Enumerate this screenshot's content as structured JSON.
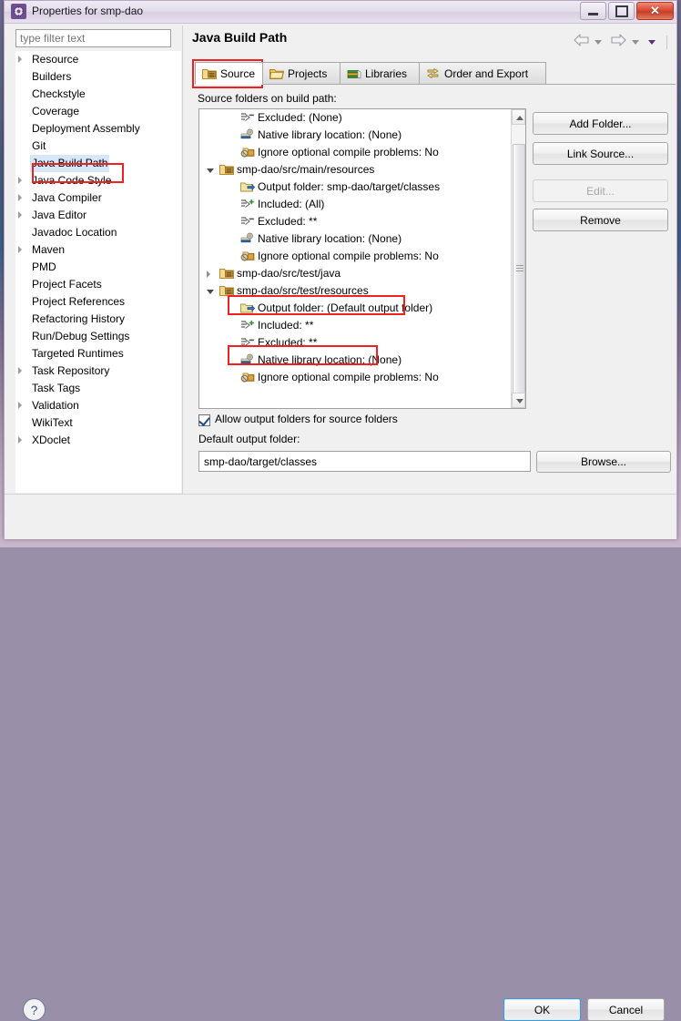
{
  "window": {
    "title": "Properties for smp-dao",
    "icon": "properties-gear-icon",
    "minimize_label": "Minimize",
    "maximize_label": "Maximize",
    "close_label": "Close",
    "close_glyph": "✕"
  },
  "filter": {
    "placeholder": "type filter text",
    "value": ""
  },
  "sidebar": {
    "items": [
      {
        "label": "Resource",
        "expandable": true,
        "selected": false
      },
      {
        "label": "Builders",
        "expandable": false,
        "selected": false
      },
      {
        "label": "Checkstyle",
        "expandable": false,
        "selected": false
      },
      {
        "label": "Coverage",
        "expandable": false,
        "selected": false
      },
      {
        "label": "Deployment Assembly",
        "expandable": false,
        "selected": false
      },
      {
        "label": "Git",
        "expandable": false,
        "selected": false
      },
      {
        "label": "Java Build Path",
        "expandable": false,
        "selected": true
      },
      {
        "label": "Java Code Style",
        "expandable": true,
        "selected": false
      },
      {
        "label": "Java Compiler",
        "expandable": true,
        "selected": false
      },
      {
        "label": "Java Editor",
        "expandable": true,
        "selected": false
      },
      {
        "label": "Javadoc Location",
        "expandable": false,
        "selected": false
      },
      {
        "label": "Maven",
        "expandable": true,
        "selected": false
      },
      {
        "label": "PMD",
        "expandable": false,
        "selected": false
      },
      {
        "label": "Project Facets",
        "expandable": false,
        "selected": false
      },
      {
        "label": "Project References",
        "expandable": false,
        "selected": false
      },
      {
        "label": "Refactoring History",
        "expandable": false,
        "selected": false
      },
      {
        "label": "Run/Debug Settings",
        "expandable": false,
        "selected": false
      },
      {
        "label": "Targeted Runtimes",
        "expandable": false,
        "selected": false
      },
      {
        "label": "Task Repository",
        "expandable": true,
        "selected": false
      },
      {
        "label": "Task Tags",
        "expandable": false,
        "selected": false
      },
      {
        "label": "Validation",
        "expandable": true,
        "selected": false
      },
      {
        "label": "WikiText",
        "expandable": false,
        "selected": false
      },
      {
        "label": "XDoclet",
        "expandable": true,
        "selected": false
      }
    ]
  },
  "page": {
    "title": "Java Build Path",
    "nav": {
      "back_icon": "arrow-left-icon",
      "back_menu_icon": "chevron-down-icon",
      "forward_icon": "arrow-right-icon",
      "forward_menu_icon": "chevron-down-icon",
      "view_menu_icon": "chevron-down-icon"
    },
    "tabs": [
      {
        "label": "Source",
        "icon": "source-folder-icon",
        "active": true
      },
      {
        "label": "Projects",
        "icon": "projects-folder-icon",
        "active": false
      },
      {
        "label": "Libraries",
        "icon": "libraries-books-icon",
        "active": false
      },
      {
        "label": "Order and Export",
        "icon": "order-export-icon",
        "active": false
      }
    ],
    "source_label": "Source folders on build path:"
  },
  "tree": {
    "rows": [
      {
        "label": "Excluded: (None)",
        "icon": "exclusion-filter-icon",
        "indent": 2,
        "toggle": "none"
      },
      {
        "label": "Native library location: (None)",
        "icon": "native-library-icon",
        "indent": 2,
        "toggle": "none"
      },
      {
        "label": "Ignore optional compile problems: No",
        "icon": "ignore-problems-icon",
        "indent": 2,
        "toggle": "none"
      },
      {
        "label": "smp-dao/src/main/resources",
        "icon": "source-folder-icon",
        "indent": 1,
        "toggle": "open"
      },
      {
        "label": "Output folder: smp-dao/target/classes",
        "icon": "output-folder-icon",
        "indent": 2,
        "toggle": "none"
      },
      {
        "label": "Included: (All)",
        "icon": "inclusion-filter-icon",
        "indent": 2,
        "toggle": "none"
      },
      {
        "label": "Excluded: **",
        "icon": "exclusion-filter-icon",
        "indent": 2,
        "toggle": "none"
      },
      {
        "label": "Native library location: (None)",
        "icon": "native-library-icon",
        "indent": 2,
        "toggle": "none"
      },
      {
        "label": "Ignore optional compile problems: No",
        "icon": "ignore-problems-icon",
        "indent": 2,
        "toggle": "none"
      },
      {
        "label": "smp-dao/src/test/java",
        "icon": "source-folder-icon",
        "indent": 1,
        "toggle": "closed"
      },
      {
        "label": "smp-dao/src/test/resources",
        "icon": "source-folder-icon",
        "indent": 1,
        "toggle": "open"
      },
      {
        "label": "Output folder: (Default output folder)",
        "icon": "output-folder-icon",
        "indent": 2,
        "toggle": "none"
      },
      {
        "label": "Included: **",
        "icon": "inclusion-filter-icon",
        "indent": 2,
        "toggle": "none"
      },
      {
        "label": "Excluded: **",
        "icon": "exclusion-filter-icon",
        "indent": 2,
        "toggle": "none"
      },
      {
        "label": "Native library location: (None)",
        "icon": "native-library-icon",
        "indent": 2,
        "toggle": "none"
      },
      {
        "label": "Ignore optional compile problems: No",
        "icon": "ignore-problems-icon",
        "indent": 2,
        "toggle": "none"
      }
    ],
    "scrollbar": {
      "up_icon": "scroll-up-icon",
      "down_icon": "scroll-down-icon",
      "thumb_grip_icon": "scroll-grip-icon"
    }
  },
  "side_buttons": {
    "add_folder": "Add Folder...",
    "link_source": "Link Source...",
    "edit": "Edit...",
    "remove": "Remove"
  },
  "output": {
    "allow_checkbox_label": "Allow output folders for source folders",
    "allow_checked": true,
    "default_label": "Default output folder:",
    "default_value": "smp-dao/target/classes",
    "browse": "Browse..."
  },
  "footer": {
    "help_icon": "help-question-icon",
    "help_glyph": "?",
    "ok": "OK",
    "cancel": "Cancel"
  },
  "annotations": {
    "highlight_color": "#ee2222",
    "boxes": [
      "Java Build Path sidebar item",
      "Source tab",
      "smp-dao/src/test/resources row",
      "Excluded: ** row"
    ]
  }
}
